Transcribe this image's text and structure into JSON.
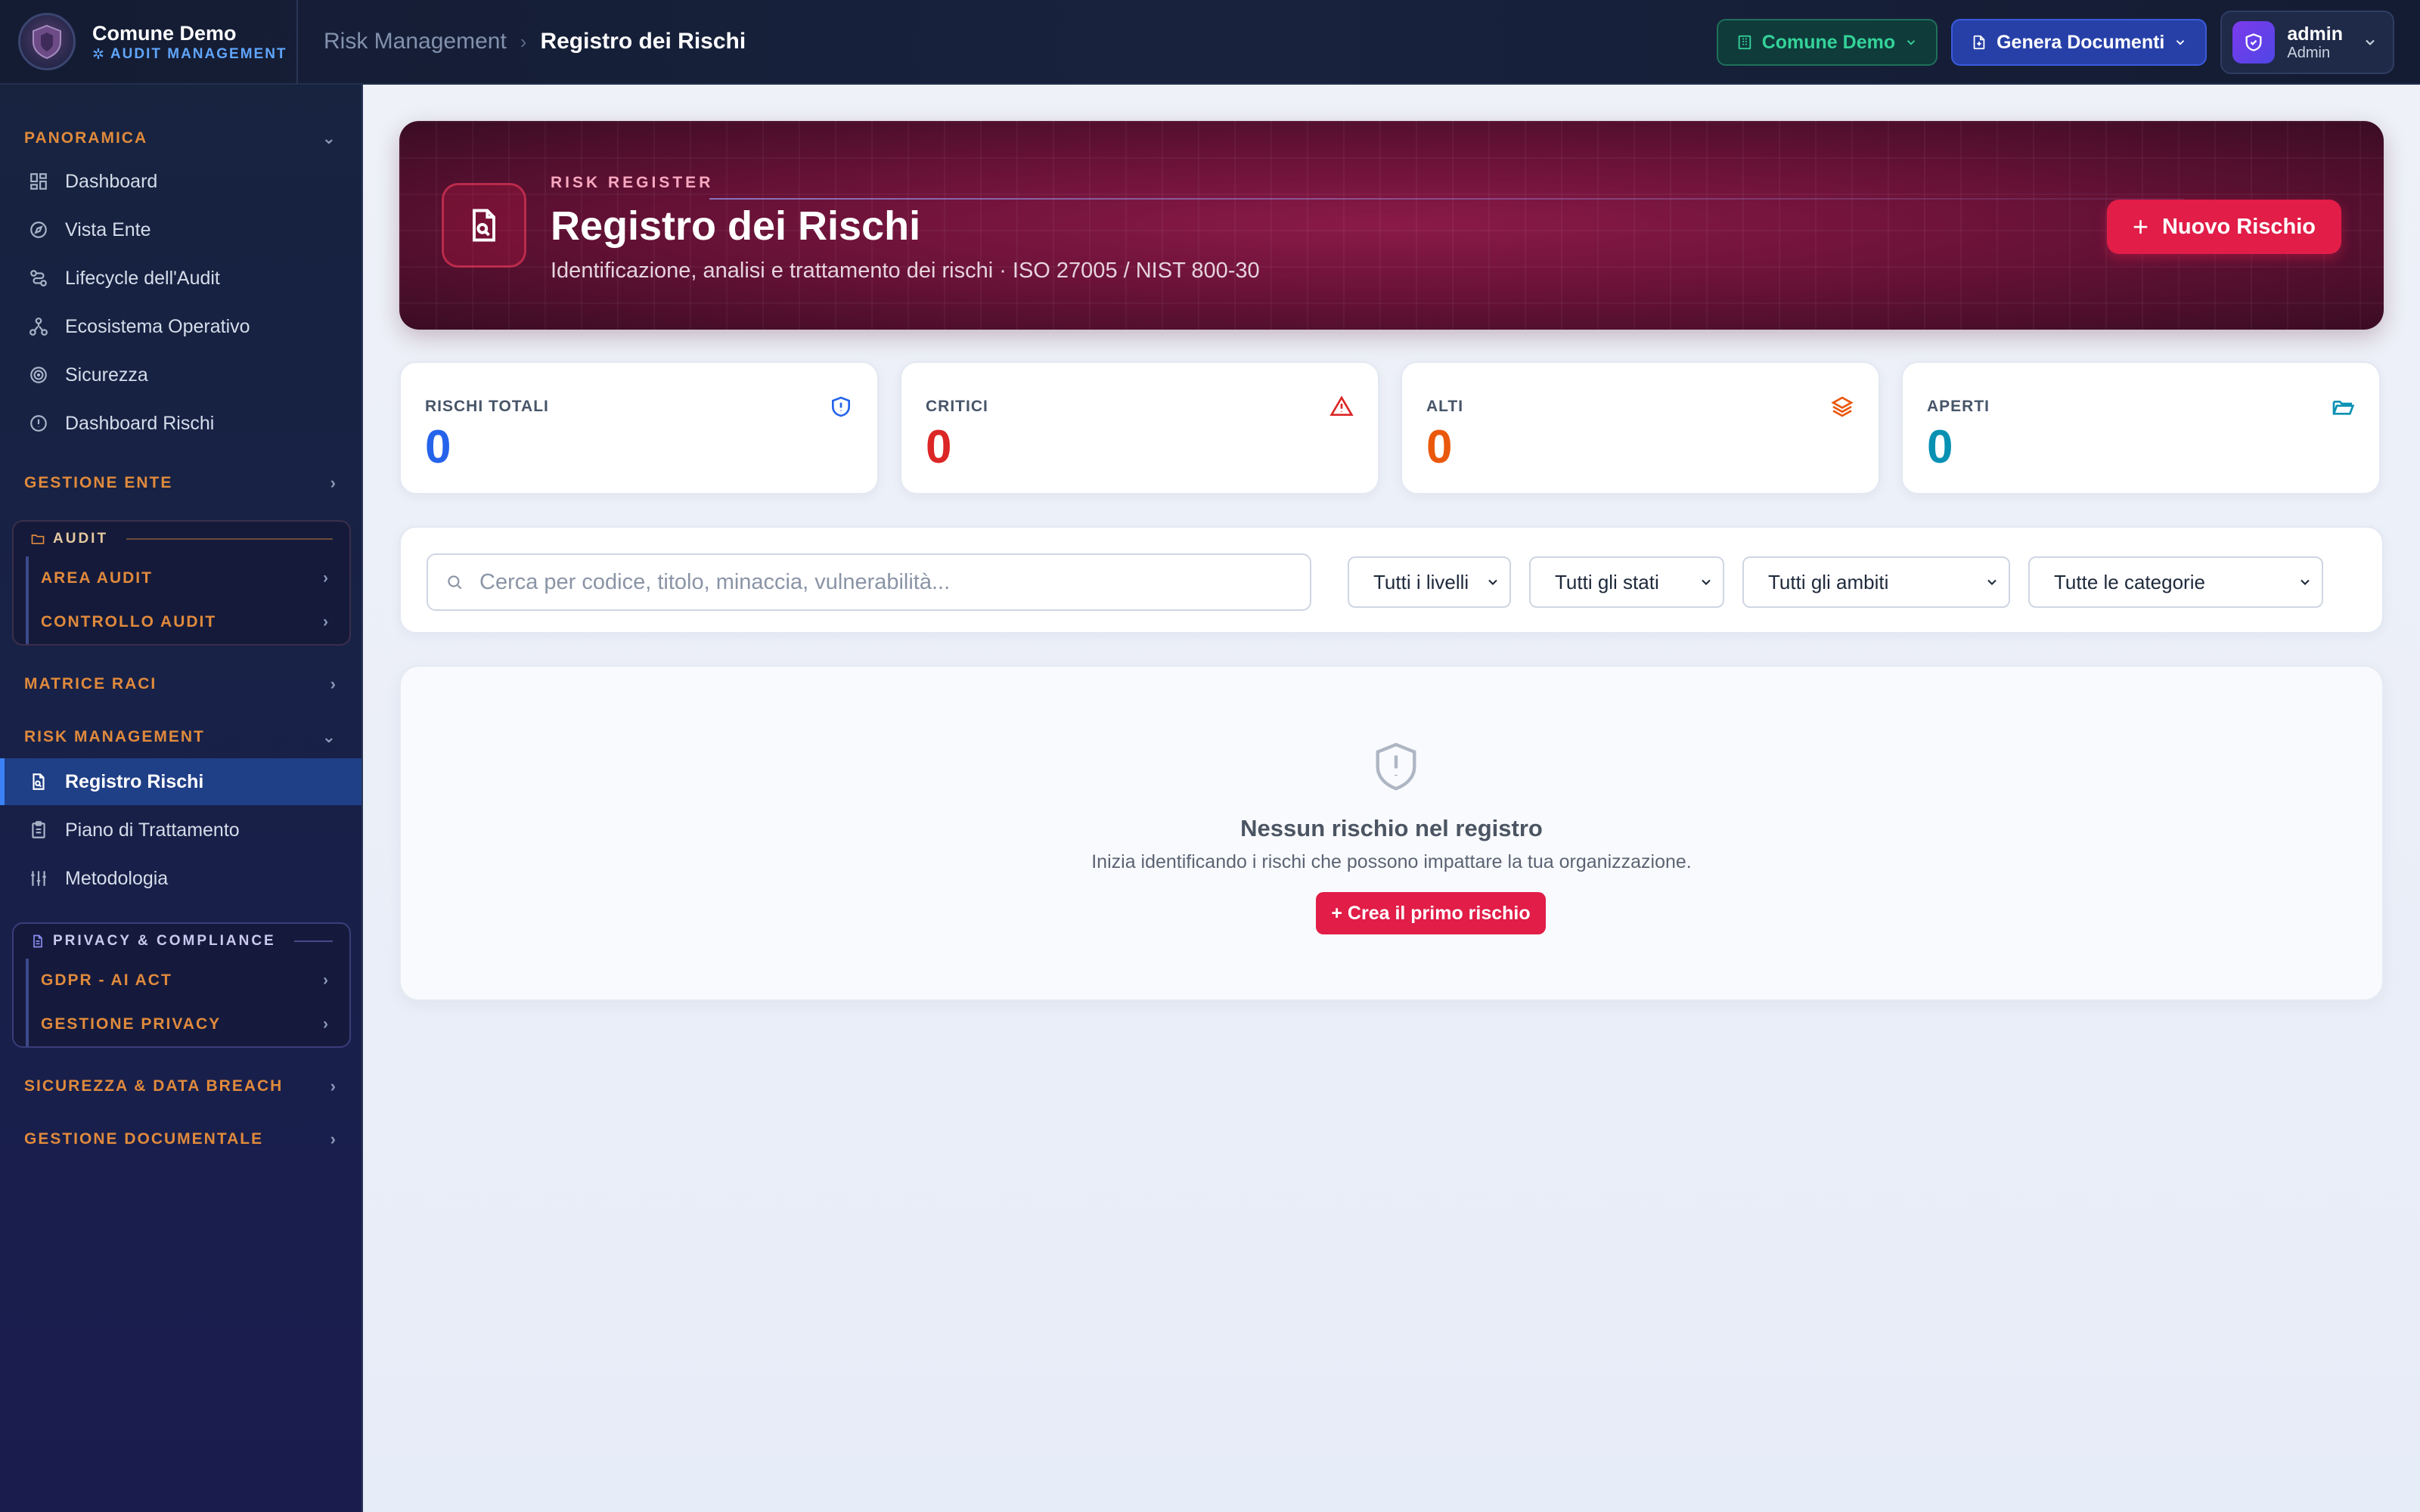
{
  "brand": {
    "name": "Comune Demo",
    "subtitle": "AUDIT MANAGEMENT"
  },
  "breadcrumb": {
    "parent": "Risk Management",
    "separator": "›",
    "current": "Registro dei Rischi"
  },
  "topbar": {
    "ente_label": "Comune Demo",
    "docs_label": "Genera Documenti",
    "user_name": "admin",
    "user_role": "Admin"
  },
  "sidebar": {
    "panoramica": {
      "title": "PANORAMICA",
      "items": [
        {
          "label": "Dashboard",
          "icon": "grid-icon"
        },
        {
          "label": "Vista Ente",
          "icon": "compass-icon"
        },
        {
          "label": "Lifecycle dell'Audit",
          "icon": "route-icon"
        },
        {
          "label": "Ecosistema Operativo",
          "icon": "network-icon"
        },
        {
          "label": "Sicurezza",
          "icon": "radar-icon"
        },
        {
          "label": "Dashboard Rischi",
          "icon": "alert-circle-icon"
        }
      ]
    },
    "gestione_ente": "GESTIONE ENTE",
    "audit_group": {
      "title": "AUDIT",
      "links": [
        "AREA AUDIT",
        "CONTROLLO AUDIT"
      ]
    },
    "matrice_raci": "MATRICE RACI",
    "risk_management": {
      "title": "RISK MANAGEMENT",
      "items": [
        {
          "label": "Registro Rischi",
          "icon": "file-search-icon"
        },
        {
          "label": "Piano di Trattamento",
          "icon": "clipboard-icon"
        },
        {
          "label": "Metodologia",
          "icon": "sliders-icon"
        }
      ]
    },
    "privacy_group": {
      "title": "PRIVACY & COMPLIANCE",
      "links": [
        "GDPR - AI ACT",
        "GESTIONE PRIVACY"
      ]
    },
    "sicurezza_breach": "SICUREZZA & DATA BREACH",
    "gestione_documentale": "GESTIONE DOCUMENTALE"
  },
  "hero": {
    "eyebrow": "RISK REGISTER",
    "title": "Registro dei Rischi",
    "subtitle": "Identificazione, analisi e trattamento dei rischi · ISO 27005 / NIST 800-30",
    "button": "Nuovo Rischio"
  },
  "stats": [
    {
      "label": "RISCHI TOTALI",
      "value": "0",
      "color": "#2563eb",
      "icon": "shield-icon"
    },
    {
      "label": "CRITICI",
      "value": "0",
      "color": "#dc2626",
      "icon": "warning-icon"
    },
    {
      "label": "ALTI",
      "value": "0",
      "color": "#ea580c",
      "icon": "layers-icon"
    },
    {
      "label": "APERTI",
      "value": "0",
      "color": "#0891b2",
      "icon": "folder-open-icon"
    }
  ],
  "filters": {
    "search_placeholder": "Cerca per codice, titolo, minaccia, vulnerabilità...",
    "livelli": "Tutti i livelli",
    "stati": "Tutti gli stati",
    "ambiti": "Tutti gli ambiti",
    "categorie": "Tutte le categorie"
  },
  "empty": {
    "title": "Nessun rischio nel registro",
    "subtitle": "Inizia identificando i rischi che possono impattare la tua organizzazione.",
    "button": "+ Crea il primo rischio"
  },
  "colors": {
    "accent": "#e11d48",
    "sidebar_section": "#e08a3c",
    "active": "#1f3f86"
  }
}
